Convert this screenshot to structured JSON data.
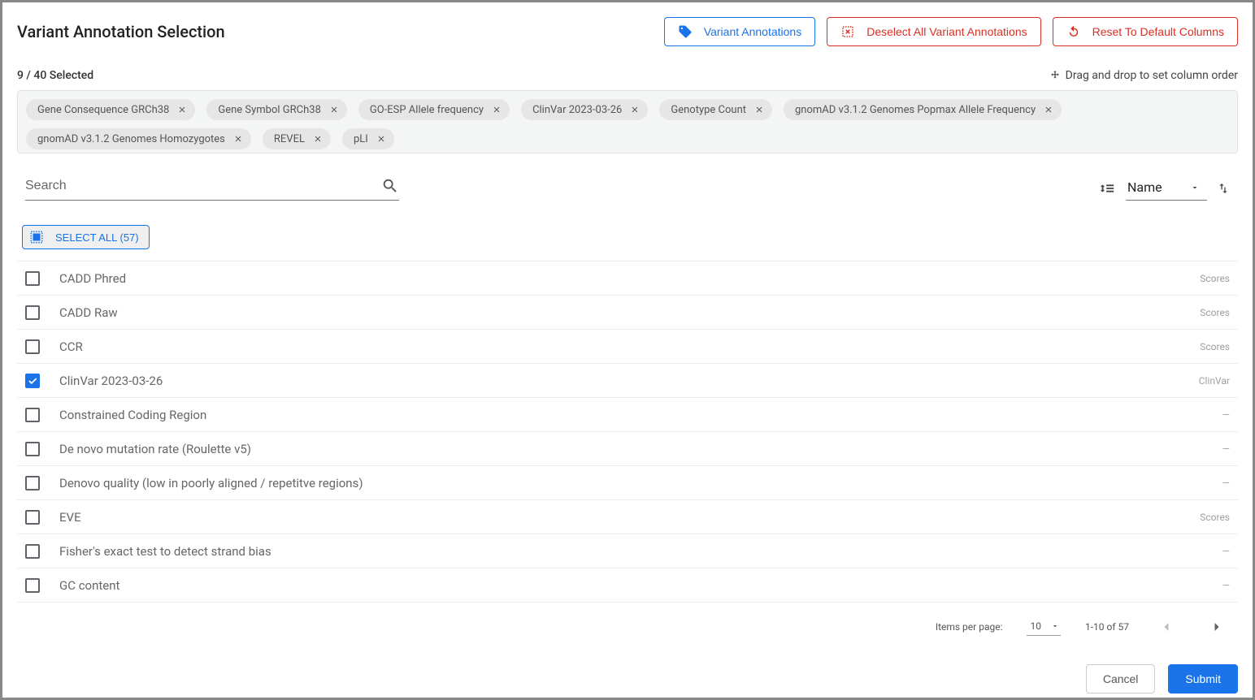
{
  "header": {
    "title": "Variant Annotation Selection",
    "variant_annotations_btn": "Variant Annotations",
    "deselect_all_btn": "Deselect All Variant Annotations",
    "reset_btn": "Reset To Default Columns"
  },
  "selection_summary": "9 / 40 Selected",
  "drag_hint": "Drag and drop to set column order",
  "chips": [
    "Gene Consequence GRCh38",
    "Gene Symbol GRCh38",
    "GO-ESP Allele frequency",
    "ClinVar 2023-03-26",
    "Genotype Count",
    "gnomAD v3.1.2 Genomes Popmax Allele Frequency",
    "gnomAD v3.1.2 Genomes Homozygotes",
    "REVEL",
    "pLI"
  ],
  "search_placeholder": "Search",
  "sort_by": "Name",
  "select_all_label": "SELECT ALL (57)",
  "rows": [
    {
      "label": "CADD Phred",
      "checked": false,
      "category": "Scores"
    },
    {
      "label": "CADD Raw",
      "checked": false,
      "category": "Scores"
    },
    {
      "label": "CCR",
      "checked": false,
      "category": "Scores"
    },
    {
      "label": "ClinVar 2023-03-26",
      "checked": true,
      "category": "ClinVar"
    },
    {
      "label": "Constrained Coding Region",
      "checked": false,
      "category": "—"
    },
    {
      "label": "De novo mutation rate (Roulette v5)",
      "checked": false,
      "category": "—"
    },
    {
      "label": "Denovo quality (low in poorly aligned / repetitve regions)",
      "checked": false,
      "category": "—"
    },
    {
      "label": "EVE",
      "checked": false,
      "category": "Scores"
    },
    {
      "label": "Fisher's exact test to detect strand bias",
      "checked": false,
      "category": "—"
    },
    {
      "label": "GC content",
      "checked": false,
      "category": "—"
    }
  ],
  "pagination": {
    "items_per_page_label": "Items per page:",
    "items_per_page": "10",
    "range": "1-10 of 57"
  },
  "footer": {
    "cancel": "Cancel",
    "submit": "Submit"
  }
}
